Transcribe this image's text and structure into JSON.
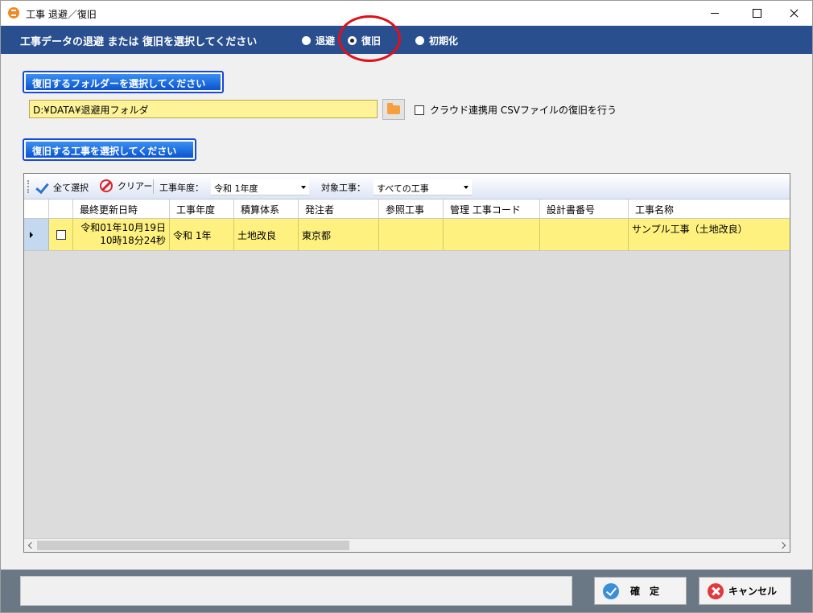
{
  "window": {
    "title": "工事 退避／復旧"
  },
  "header": {
    "heading": "工事データの退避 または 復旧を選択してください",
    "options": [
      {
        "label": "退避",
        "checked": false
      },
      {
        "label": "復旧",
        "checked": true
      },
      {
        "label": "初期化",
        "checked": false
      }
    ]
  },
  "folder_section": {
    "label": "復旧するフォルダーを選択してください",
    "path": "D:¥DATA¥退避用フォルダ",
    "cloud_option": "クラウド連携用 CSVファイルの復旧を行う",
    "cloud_checked": false
  },
  "project_section": {
    "label": "復旧する工事を選択してください"
  },
  "toolbar": {
    "select_all": "全て選択",
    "clear": "クリアー",
    "year_label": "工事年度：",
    "year_value": "令和 1年度",
    "target_label": "対象工事：",
    "target_value": "すべての工事"
  },
  "grid": {
    "columns": [
      "最終更新日時",
      "工事年度",
      "積算体系",
      "発注者",
      "参照工事",
      "管理 工事コード",
      "設計書番号",
      "工事名称"
    ],
    "rows": [
      {
        "checked": false,
        "date_line1": "令和01年10月19日",
        "date_line2": "10時18分24秒",
        "year": "令和 1年",
        "system": "土地改良",
        "client": "東京都",
        "ref": "",
        "code": "",
        "design_no": "",
        "name": "サンプル工事（土地改良）"
      }
    ]
  },
  "footer": {
    "status": "",
    "ok": "確　定",
    "cancel": "キャンセル"
  }
}
